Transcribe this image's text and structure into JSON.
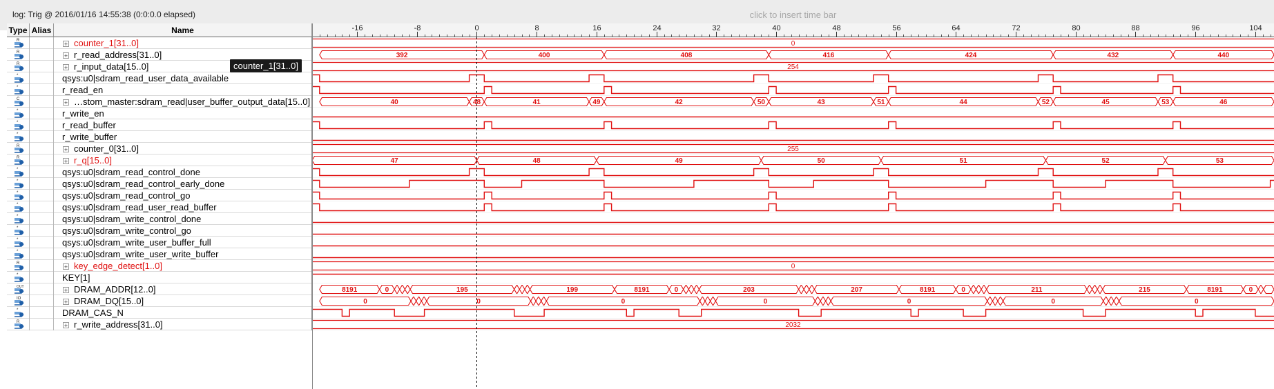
{
  "top_bar": {
    "log_text": "log: Trig @ 2016/01/16 14:55:38 (0:0:0.0 elapsed)",
    "insert_hint": "click to insert time bar"
  },
  "columns": {
    "type": "Type",
    "alias": "Alias",
    "name": "Name"
  },
  "tooltip": "counter_1[31..0]",
  "colors": {
    "waveform": "#e01010",
    "cursor": "#000000",
    "icon_blue": "#1f5fa8"
  },
  "timeline": {
    "ticks": [
      "-16",
      "-8",
      "0",
      "8",
      "16",
      "24",
      "32",
      "40",
      "48",
      "56",
      "64",
      "72",
      "80",
      "88",
      "96",
      "104"
    ],
    "tick_values": [
      -16,
      -8,
      0,
      8,
      16,
      24,
      32,
      40,
      48,
      56,
      64,
      72,
      80,
      88,
      96,
      104
    ],
    "min": -22,
    "max": 106.5,
    "cursor": 0
  },
  "signals": [
    {
      "name": "counter_1[31..0]",
      "icon": "register",
      "expandable": true,
      "red": true,
      "kind": "bus",
      "segments": [
        {
          "label": "0",
          "from": -22,
          "to": 106.5
        }
      ]
    },
    {
      "name": "r_read_address[31..0]",
      "icon": "register",
      "expandable": true,
      "red": false,
      "kind": "bus",
      "segments": [
        {
          "label": "392",
          "from": -21,
          "to": 1
        },
        {
          "label": "400",
          "from": 1,
          "to": 17
        },
        {
          "label": "408",
          "from": 17,
          "to": 39
        },
        {
          "label": "416",
          "from": 39,
          "to": 55
        },
        {
          "label": "424",
          "from": 55,
          "to": 77
        },
        {
          "label": "432",
          "from": 77,
          "to": 93
        },
        {
          "label": "440",
          "from": 93,
          "to": 106.5
        }
      ]
    },
    {
      "name": "r_input_data[15..0]",
      "icon": "register",
      "expandable": true,
      "red": false,
      "kind": "bus",
      "segments": [
        {
          "label": "254",
          "from": -22,
          "to": 106.5
        }
      ]
    },
    {
      "name": "qsys:u0|sdram_read_user_data_available",
      "icon": "signal",
      "expandable": false,
      "red": false,
      "kind": "bit",
      "init": 1,
      "edges": [
        -21,
        -1,
        1,
        15,
        17,
        37,
        39,
        53,
        55,
        75,
        77,
        91,
        93
      ]
    },
    {
      "name": "r_read_en",
      "icon": "signal",
      "expandable": false,
      "red": false,
      "kind": "bit",
      "init": 1,
      "edges": [
        -21,
        1,
        2,
        17,
        18,
        39,
        40,
        55,
        56,
        77,
        78,
        93,
        94
      ]
    },
    {
      "name": "…stom_master:sdram_read|user_buffer_output_data[15..0]",
      "icon": "composite",
      "expandable": true,
      "red": false,
      "kind": "bus",
      "segments": [
        {
          "label": "40",
          "from": -21,
          "to": -1
        },
        {
          "label": "48",
          "from": -1,
          "to": 1
        },
        {
          "label": "41",
          "from": 1,
          "to": 15
        },
        {
          "label": "49",
          "from": 15,
          "to": 17
        },
        {
          "label": "42",
          "from": 17,
          "to": 37
        },
        {
          "label": "50",
          "from": 37,
          "to": 39
        },
        {
          "label": "43",
          "from": 39,
          "to": 53
        },
        {
          "label": "51",
          "from": 53,
          "to": 55
        },
        {
          "label": "44",
          "from": 55,
          "to": 75
        },
        {
          "label": "52",
          "from": 75,
          "to": 77
        },
        {
          "label": "45",
          "from": 77,
          "to": 91
        },
        {
          "label": "53",
          "from": 91,
          "to": 93
        },
        {
          "label": "46",
          "from": 93,
          "to": 106.5
        }
      ]
    },
    {
      "name": "r_write_en",
      "icon": "signal",
      "expandable": false,
      "red": false,
      "kind": "bit",
      "init": 0,
      "edges": []
    },
    {
      "name": "r_read_buffer",
      "icon": "signal",
      "expandable": false,
      "red": false,
      "kind": "bit",
      "init": 1,
      "edges": [
        -21,
        1,
        2,
        17,
        18,
        39,
        40,
        55,
        56,
        77,
        78,
        93,
        94
      ]
    },
    {
      "name": "r_write_buffer",
      "icon": "signal",
      "expandable": false,
      "red": false,
      "kind": "bit",
      "init": 0,
      "edges": []
    },
    {
      "name": "counter_0[31..0]",
      "icon": "register",
      "expandable": true,
      "red": false,
      "kind": "bus",
      "segments": [
        {
          "label": "255",
          "from": -22,
          "to": 106.5
        }
      ]
    },
    {
      "name": "r_q[15..0]",
      "icon": "register",
      "expandable": true,
      "red": true,
      "kind": "bus",
      "segments": [
        {
          "label": "47",
          "from": -22,
          "to": 0
        },
        {
          "label": "48",
          "from": 0,
          "to": 16
        },
        {
          "label": "49",
          "from": 16,
          "to": 38
        },
        {
          "label": "50",
          "from": 38,
          "to": 54
        },
        {
          "label": "51",
          "from": 54,
          "to": 76
        },
        {
          "label": "52",
          "from": 76,
          "to": 92
        },
        {
          "label": "53",
          "from": 92,
          "to": 106.5
        }
      ]
    },
    {
      "name": "qsys:u0|sdram_read_control_done",
      "icon": "signal",
      "expandable": false,
      "red": false,
      "kind": "bit",
      "init": 1,
      "edges": [
        -21,
        -1,
        1,
        15,
        17,
        37,
        39,
        53,
        55,
        75,
        77,
        91,
        93
      ]
    },
    {
      "name": "qsys:u0|sdram_read_control_early_done",
      "icon": "signal",
      "expandable": false,
      "red": false,
      "kind": "bit",
      "init": 1,
      "edges": [
        -21,
        -9,
        1,
        6,
        17,
        29,
        39,
        45,
        55,
        68,
        77,
        84,
        93,
        106
      ]
    },
    {
      "name": "qsys:u0|sdram_read_control_go",
      "icon": "signal",
      "expandable": false,
      "red": false,
      "kind": "bit",
      "init": 1,
      "edges": [
        -21,
        1,
        2,
        17,
        18,
        39,
        40,
        55,
        56,
        77,
        78,
        93,
        94
      ]
    },
    {
      "name": "qsys:u0|sdram_read_user_read_buffer",
      "icon": "signal",
      "expandable": false,
      "red": false,
      "kind": "bit",
      "init": 1,
      "edges": [
        -21,
        1,
        2,
        17,
        18,
        39,
        40,
        55,
        56,
        77,
        78,
        93,
        94
      ]
    },
    {
      "name": "qsys:u0|sdram_write_control_done",
      "icon": "signal",
      "expandable": false,
      "red": false,
      "kind": "bit",
      "init": 0,
      "edges": []
    },
    {
      "name": "qsys:u0|sdram_write_control_go",
      "icon": "signal",
      "expandable": false,
      "red": false,
      "kind": "bit",
      "init": 0,
      "edges": []
    },
    {
      "name": "qsys:u0|sdram_write_user_buffer_full",
      "icon": "signal",
      "expandable": false,
      "red": false,
      "kind": "bit",
      "init": 0,
      "edges": []
    },
    {
      "name": "qsys:u0|sdram_write_user_write_buffer",
      "icon": "signal",
      "expandable": false,
      "red": false,
      "kind": "bit",
      "init": 0,
      "edges": []
    },
    {
      "name": "key_edge_detect[1..0]",
      "icon": "register",
      "expandable": true,
      "red": true,
      "kind": "bus",
      "segments": [
        {
          "label": "0",
          "from": -22,
          "to": 106.5
        }
      ]
    },
    {
      "name": "KEY[1]",
      "icon": "signal",
      "expandable": false,
      "red": false,
      "kind": "bit",
      "init": 1,
      "edges": []
    },
    {
      "name": "DRAM_ADDR[12..0]",
      "icon": "output",
      "expandable": true,
      "red": false,
      "kind": "bus",
      "segments": [
        {
          "label": "8191",
          "from": -21,
          "to": -13
        },
        {
          "label": "0",
          "from": -13,
          "to": -11
        },
        {
          "label": "",
          "from": -11,
          "to": -10.3
        },
        {
          "label": "",
          "from": -10.3,
          "to": -9.6
        },
        {
          "label": "",
          "from": -9.6,
          "to": -8.9
        },
        {
          "label": "195",
          "from": -8.9,
          "to": 5
        },
        {
          "label": "",
          "from": 5,
          "to": 5.7
        },
        {
          "label": "",
          "from": 5.7,
          "to": 6.4
        },
        {
          "label": "",
          "from": 6.4,
          "to": 7.1
        },
        {
          "label": "199",
          "from": 7.1,
          "to": 18.4
        },
        {
          "label": "8191",
          "from": 18.4,
          "to": 25.7
        },
        {
          "label": "0",
          "from": 25.7,
          "to": 27.6
        },
        {
          "label": "",
          "from": 27.6,
          "to": 28.3
        },
        {
          "label": "",
          "from": 28.3,
          "to": 29
        },
        {
          "label": "",
          "from": 29,
          "to": 29.7
        },
        {
          "label": "203",
          "from": 29.7,
          "to": 43
        },
        {
          "label": "",
          "from": 43,
          "to": 43.7
        },
        {
          "label": "",
          "from": 43.7,
          "to": 44.4
        },
        {
          "label": "",
          "from": 44.4,
          "to": 45.1
        },
        {
          "label": "207",
          "from": 45.1,
          "to": 56.4
        },
        {
          "label": "8191",
          "from": 56.4,
          "to": 64
        },
        {
          "label": "0",
          "from": 64,
          "to": 66
        },
        {
          "label": "",
          "from": 66,
          "to": 66.7
        },
        {
          "label": "",
          "from": 66.7,
          "to": 67.4
        },
        {
          "label": "",
          "from": 67.4,
          "to": 68.1
        },
        {
          "label": "211",
          "from": 68.1,
          "to": 81.5
        },
        {
          "label": "",
          "from": 81.5,
          "to": 82.2
        },
        {
          "label": "",
          "from": 82.2,
          "to": 82.9
        },
        {
          "label": "",
          "from": 82.9,
          "to": 83.6
        },
        {
          "label": "215",
          "from": 83.6,
          "to": 94.8
        },
        {
          "label": "8191",
          "from": 94.8,
          "to": 102.4
        },
        {
          "label": "0",
          "from": 102.4,
          "to": 104.4
        },
        {
          "label": "",
          "from": 104.4,
          "to": 105.1
        },
        {
          "label": "",
          "from": 105.1,
          "to": 106.5
        }
      ]
    },
    {
      "name": "DRAM_DQ[15..0]",
      "icon": "bidir",
      "expandable": true,
      "red": false,
      "kind": "bus",
      "segments": [
        {
          "label": "0",
          "from": -21,
          "to": -8.8
        },
        {
          "label": "",
          "from": -8.8,
          "to": -8.1
        },
        {
          "label": "",
          "from": -8.1,
          "to": -7.4
        },
        {
          "label": "",
          "from": -7.4,
          "to": -6.7
        },
        {
          "label": "0",
          "from": -6.7,
          "to": 7.2
        },
        {
          "label": "",
          "from": 7.2,
          "to": 7.9
        },
        {
          "label": "",
          "from": 7.9,
          "to": 8.6
        },
        {
          "label": "",
          "from": 8.6,
          "to": 9.3
        },
        {
          "label": "0",
          "from": 9.3,
          "to": 29.8
        },
        {
          "label": "",
          "from": 29.8,
          "to": 30.5
        },
        {
          "label": "",
          "from": 30.5,
          "to": 31.2
        },
        {
          "label": "",
          "from": 31.2,
          "to": 31.9
        },
        {
          "label": "0",
          "from": 31.9,
          "to": 45.2
        },
        {
          "label": "",
          "from": 45.2,
          "to": 45.9
        },
        {
          "label": "",
          "from": 45.9,
          "to": 46.6
        },
        {
          "label": "",
          "from": 46.6,
          "to": 47.3
        },
        {
          "label": "0",
          "from": 47.3,
          "to": 68.2
        },
        {
          "label": "",
          "from": 68.2,
          "to": 68.9
        },
        {
          "label": "",
          "from": 68.9,
          "to": 69.6
        },
        {
          "label": "",
          "from": 69.6,
          "to": 70.3
        },
        {
          "label": "0",
          "from": 70.3,
          "to": 83.7
        },
        {
          "label": "",
          "from": 83.7,
          "to": 84.4
        },
        {
          "label": "",
          "from": 84.4,
          "to": 85.1
        },
        {
          "label": "",
          "from": 85.1,
          "to": 85.8
        },
        {
          "label": "0",
          "from": 85.8,
          "to": 106.5
        }
      ]
    },
    {
      "name": "DRAM_CAS_N",
      "icon": "signal",
      "expandable": false,
      "red": false,
      "kind": "bit",
      "init": 1,
      "edges": [
        -18,
        -17,
        -11,
        -7,
        5,
        9,
        20,
        21,
        27,
        30,
        43,
        46,
        58,
        59,
        65,
        68,
        81,
        84,
        96,
        97,
        104
      ]
    },
    {
      "name": "r_write_address[31..0]",
      "icon": "register",
      "expandable": true,
      "red": false,
      "kind": "bus",
      "segments": [
        {
          "label": "2032",
          "from": -22,
          "to": 106.5
        }
      ]
    }
  ]
}
